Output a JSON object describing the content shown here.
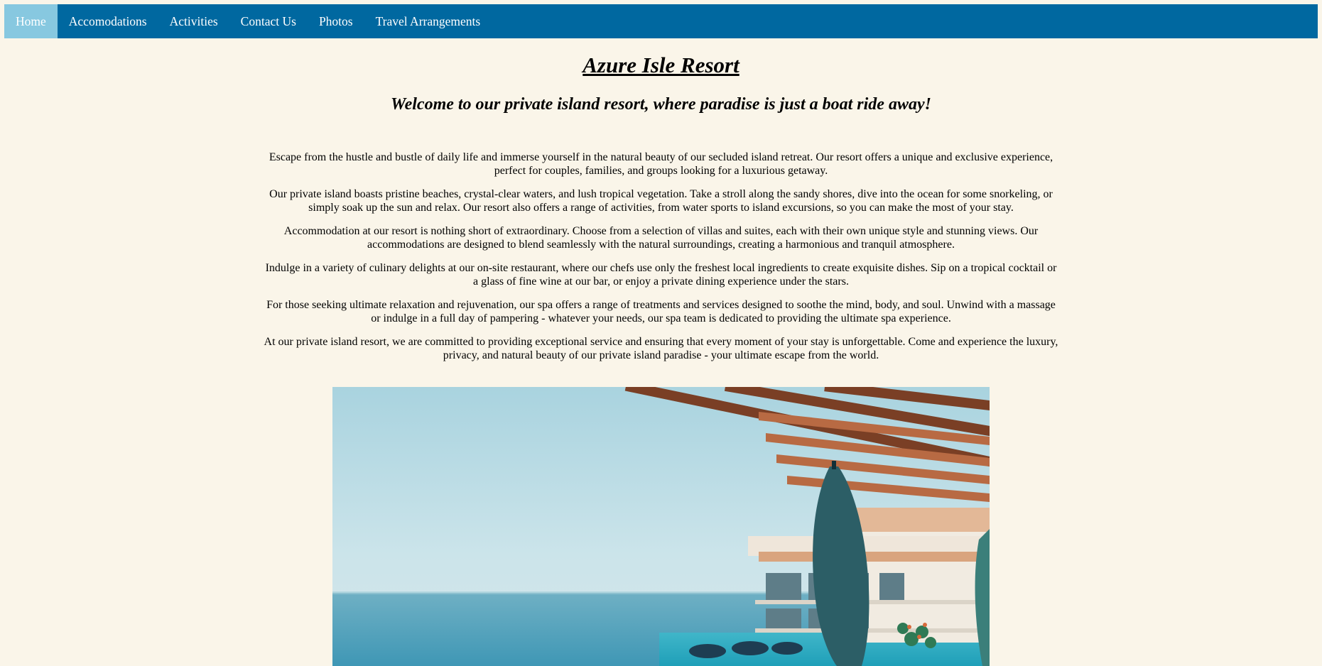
{
  "nav": {
    "items": [
      {
        "label": "Home",
        "active": true
      },
      {
        "label": "Accomodations",
        "active": false
      },
      {
        "label": "Activities",
        "active": false
      },
      {
        "label": "Contact Us",
        "active": false
      },
      {
        "label": "Photos",
        "active": false
      },
      {
        "label": "Travel Arrangements",
        "active": false
      }
    ]
  },
  "header": {
    "title": "Azure Isle Resort",
    "tagline": "Welcome to our private island resort, where paradise is just a boat ride away!"
  },
  "main": {
    "paragraphs": [
      "Escape from the hustle and bustle of daily life and immerse yourself in the natural beauty of our secluded island retreat. Our resort offers a unique and exclusive experience, perfect for couples, families, and groups looking for a luxurious getaway.",
      "Our private island boasts pristine beaches, crystal-clear waters, and lush tropical vegetation. Take a stroll along the sandy shores, dive into the ocean for some snorkeling, or simply soak up the sun and relax. Our resort also offers a range of activities, from water sports to island excursions, so you can make the most of your stay.",
      "Accommodation at our resort is nothing short of extraordinary. Choose from a selection of villas and suites, each with their own unique style and stunning views. Our accommodations are designed to blend seamlessly with the natural surroundings, creating a harmonious and tranquil atmosphere.",
      "Indulge in a variety of culinary delights at our on-site restaurant, where our chefs use only the freshest local ingredients to create exquisite dishes. Sip on a tropical cocktail or a glass of fine wine at our bar, or enjoy a private dining experience under the stars.",
      "For those seeking ultimate relaxation and rejuvenation, our spa offers a range of treatments and services designed to soothe the mind, body, and soul. Unwind with a massage or indulge in a full day of pampering - whatever your needs, our spa team is dedicated to providing the ultimate spa experience.",
      "At our private island resort, we are committed to providing exceptional service and ensuring that every moment of your stay is unforgettable. Come and experience the luxury, privacy, and natural beauty of our private island paradise - your ultimate escape from the world."
    ]
  },
  "colors": {
    "page_background": "#faf5e9",
    "nav_background": "#0068a0",
    "nav_active": "#87c8e0",
    "nav_text": "#ffffff"
  }
}
